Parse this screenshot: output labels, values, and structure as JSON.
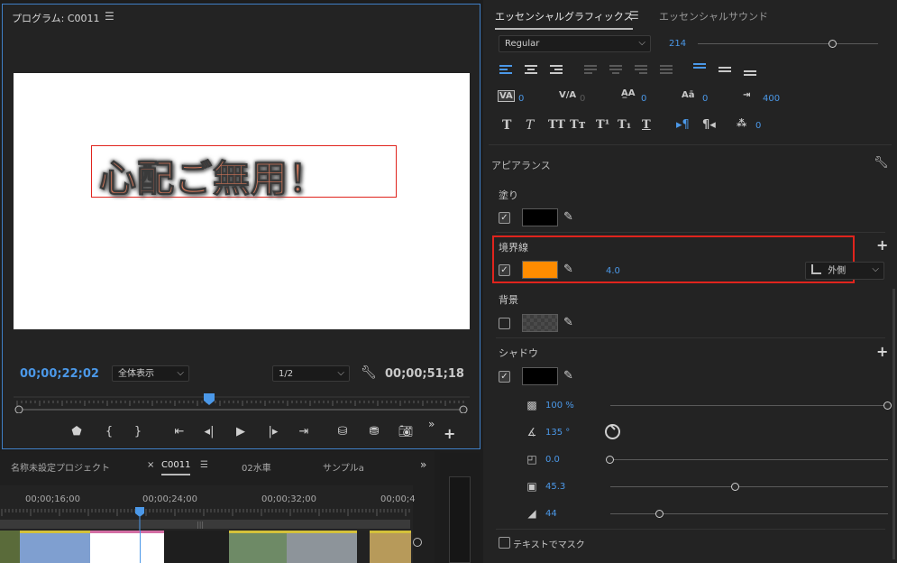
{
  "program": {
    "title": "プログラム: C0011",
    "canvas_text": "心配ご無用！",
    "current_time": "00;00;22;02",
    "fit_label": "全体表示",
    "resolution_label": "1/2",
    "duration": "00;00;51;18"
  },
  "bottom": {
    "tabs": [
      "名称未設定プロジェクト",
      "C0011",
      "02水車",
      "サンプルa"
    ],
    "timeline_times": [
      "00;00;16;00",
      "00;00;24;00",
      "00;00;32;00",
      "00;00;4"
    ]
  },
  "essential_graphics": {
    "tab_active": "エッセンシャルグラフィックス",
    "tab_inactive": "エッセンシャルサウンド",
    "font_style": "Regular",
    "font_size": "214",
    "font_size_fraction": 0.75,
    "kerning": "0",
    "tracking": "0",
    "baseline_shift": "0",
    "tsume": "0",
    "leading": "400",
    "tab_width": "0",
    "appearance_label": "アピアランス",
    "fill_label": "塗り",
    "fill_color": "#000000",
    "stroke_label": "境界線",
    "stroke_color": "#ff8c00",
    "stroke_width": "4.0",
    "stroke_position": "外側",
    "background_label": "背景",
    "shadow_label": "シャドウ",
    "shadow_color": "#000000",
    "shadow_opacity": "100 %",
    "shadow_angle": "135 °",
    "shadow_distance": "0.0",
    "shadow_size": "45.3",
    "shadow_blur": "44",
    "shadow_opacity_fraction": 1.0,
    "shadow_distance_fraction": 0.0,
    "shadow_size_fraction": 0.45,
    "shadow_blur_fraction": 0.18,
    "mask_label": "テキストでマスク"
  },
  "colors": {
    "accent_blue": "#4b98e8",
    "highlight_red": "#e0241d"
  }
}
